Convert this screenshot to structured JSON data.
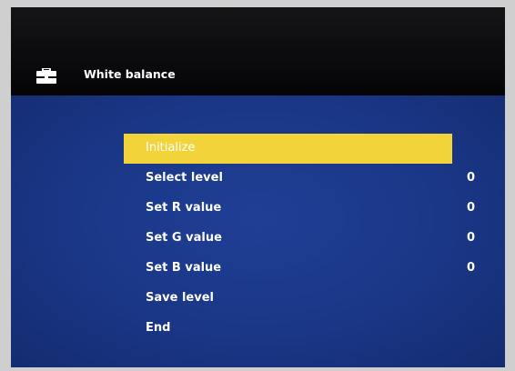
{
  "window": {
    "title": "White balance",
    "title_icon": "toolbox-icon"
  },
  "menu": {
    "items": [
      {
        "label": "Initialize",
        "value": "",
        "selected": true
      },
      {
        "label": "Select level",
        "value": "0",
        "selected": false
      },
      {
        "label": "Set R value",
        "value": "0",
        "selected": false
      },
      {
        "label": "Set G value",
        "value": "0",
        "selected": false
      },
      {
        "label": "Set B value",
        "value": "0",
        "selected": false
      },
      {
        "label": "Save level",
        "value": "",
        "selected": false
      },
      {
        "label": "End",
        "value": "",
        "selected": false
      }
    ]
  },
  "colors": {
    "highlight": "#f2d33a",
    "menu_background": "#1a3686",
    "header_background": "#0b0b0e",
    "text": "#ffffff"
  }
}
